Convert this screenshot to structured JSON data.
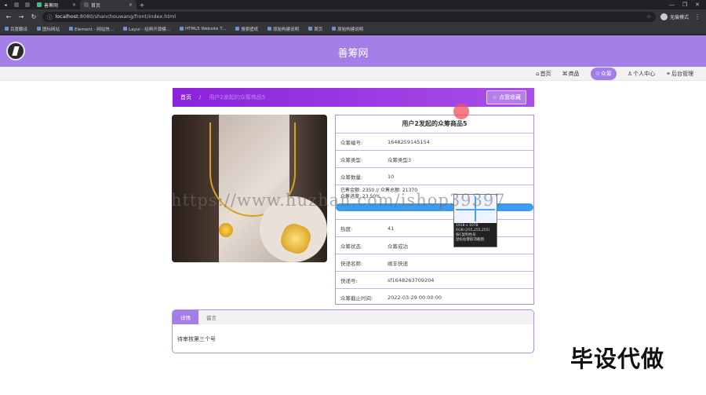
{
  "browser": {
    "tabs": [
      {
        "label": "善筹网",
        "active": false
      },
      {
        "label": "首页",
        "active": true
      }
    ],
    "url_host": "localhost",
    "url_rest": ":8080/shanchouwang/front/index.html",
    "profile_label": "无痕模式",
    "bookmarks": [
      "百度翻译",
      "图标网站",
      "Element - 网站快...",
      "Layui - 经典开源模...",
      "HTML5 Website T...",
      "搜索壁纸",
      "原始构建说明",
      "首页",
      "原始构建说明"
    ]
  },
  "site": {
    "title": "善筹网",
    "nav": [
      {
        "label": "首页",
        "icon": "home-icon"
      },
      {
        "label": "商品",
        "icon": "goods-icon"
      },
      {
        "label": "众筹",
        "icon": "crowdfund-icon",
        "active": true
      },
      {
        "label": "个人中心",
        "icon": "user-icon"
      },
      {
        "label": "后台管理",
        "icon": "link-icon"
      }
    ]
  },
  "breadcrumb": {
    "home": "首页",
    "current": "用户2发起的众筹商品5",
    "collect_label": "☆ 点我收藏"
  },
  "product": {
    "title": "用户2发起的众筹商品5",
    "rows": [
      {
        "k": "众筹编号:",
        "v": "1648259145154"
      },
      {
        "k": "众筹类型:",
        "v": "众筹类型3"
      },
      {
        "k": "众筹数量:",
        "v": "10"
      }
    ],
    "progress": {
      "line1": "已筹金额: 2350 // 众筹总额: 21370",
      "line2": "众筹进度: 23.50%",
      "fraction": 1.0
    },
    "rows2": [
      {
        "k": "热度:",
        "v": "41"
      },
      {
        "k": "众筹状态:",
        "v": "众筹成功"
      },
      {
        "k": "快递名称:",
        "v": "顺丰快递"
      },
      {
        "k": "快递号:",
        "v": "sf1648263709204"
      },
      {
        "k": "众筹截止时间:",
        "v": "2022-03-29 00:00:00"
      }
    ]
  },
  "screenshot_tool": {
    "size": "1918 x 1078",
    "rgb": "RGB:(255,255,255)",
    "hint1": "按C复制色号",
    "hint2": "鼠标右键取消截图"
  },
  "detail_tabs": {
    "tabs": [
      "详情",
      "留言"
    ],
    "content": "待审核第三个号"
  },
  "overlays": {
    "watermark": "https://www.huzhan.com/ishop39397",
    "corner": "毕设代做"
  },
  "colors": {
    "header": "#a37ee6",
    "crumb": "#9a2be2",
    "progress": "#3d9cf0"
  }
}
